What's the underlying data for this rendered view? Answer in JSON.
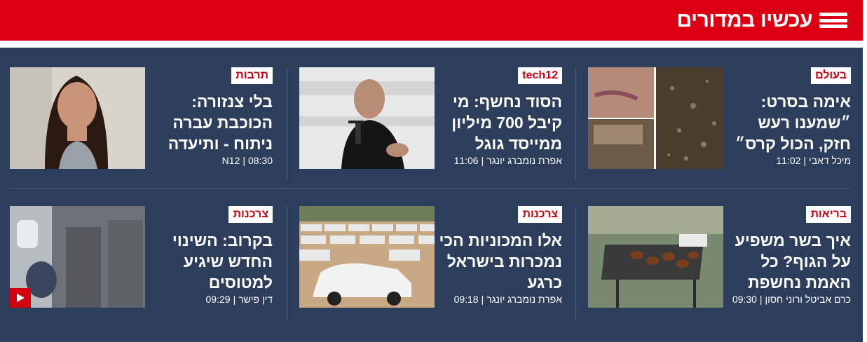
{
  "header": {
    "title": "עכשיו במדורים",
    "menu_icon": "menu-icon"
  },
  "colors": {
    "brand_red": "#dd0012",
    "panel": "#2d3d5c",
    "tag_text": "#c8000f"
  },
  "cards": [
    {
      "tag": "בעולם",
      "headline": "אימה בסרט: ״שמענו רעש חזק, הכול קרס״",
      "author": "מיכל דאבי",
      "time": "11:02",
      "thumb": "crash-aftermath-photo"
    },
    {
      "tag": "tech12",
      "headline": "הסוד נחשף: מי קיבל 700 מיליון ממייסד גוגל",
      "author": "אפרת נומברג יונגר",
      "time": "11:06",
      "thumb": "speaker-at-podium-photo"
    },
    {
      "tag": "תרבות",
      "headline": "בלי צנזורה: הכוכבת עברה ניתוח - ותיעדה",
      "author": "N12",
      "time": "08:30",
      "thumb": "celebrity-portrait-photo"
    },
    {
      "tag": "בריאות",
      "headline": "איך בשר משפיע על הגוף? כל האמת נחשפת",
      "author": "כרם אביטל ורוני חסון",
      "time": "09:30",
      "thumb": "barbecue-grill-photo"
    },
    {
      "tag": "צרכנות",
      "headline": "אלו המכוניות הכי נמכרות בישראל כרגע",
      "author": "אפרת נומברג יונגר",
      "time": "09:18",
      "thumb": "car-lot-photo"
    },
    {
      "tag": "צרכנות",
      "headline": "בקרוב: השינוי החדש שיגיע למטוסים",
      "author": "דין פישר",
      "time": "09:29",
      "thumb": "airplane-cabin-photo",
      "video": true
    }
  ]
}
